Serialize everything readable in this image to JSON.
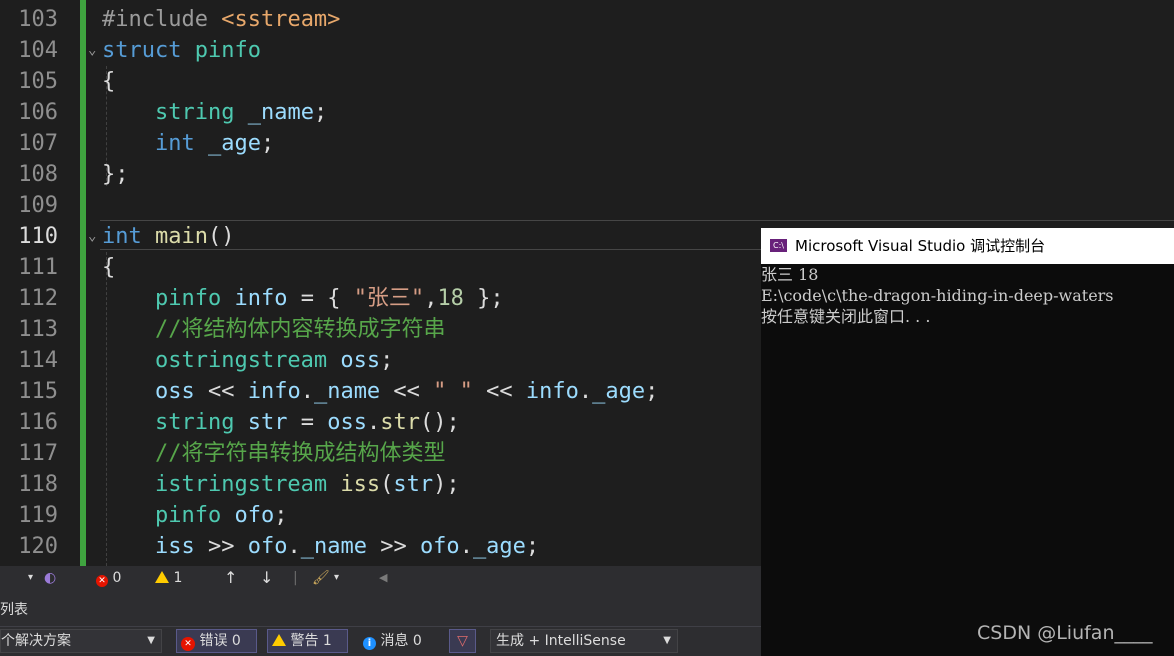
{
  "editor": {
    "current_line": "110",
    "lines": [
      {
        "n": "103",
        "t": [
          {
            "c": "pp",
            "s": "#include "
          },
          {
            "c": "inc",
            "s": "<sstream>"
          }
        ]
      },
      {
        "n": "104",
        "t": [
          {
            "c": "kw",
            "s": "struct"
          },
          {
            "c": "",
            "s": " "
          },
          {
            "c": "ty",
            "s": "pinfo"
          }
        ]
      },
      {
        "n": "105",
        "t": [
          {
            "c": "",
            "s": "{"
          }
        ]
      },
      {
        "n": "106",
        "t": [
          {
            "c": "",
            "s": "    "
          },
          {
            "c": "ty",
            "s": "string"
          },
          {
            "c": "",
            "s": " "
          },
          {
            "c": "var",
            "s": "_name"
          },
          {
            "c": "",
            "s": ";"
          }
        ]
      },
      {
        "n": "107",
        "t": [
          {
            "c": "",
            "s": "    "
          },
          {
            "c": "kw",
            "s": "int"
          },
          {
            "c": "",
            "s": " "
          },
          {
            "c": "var",
            "s": "_age"
          },
          {
            "c": "",
            "s": ";"
          }
        ]
      },
      {
        "n": "108",
        "t": [
          {
            "c": "",
            "s": "};"
          }
        ]
      },
      {
        "n": "109",
        "t": []
      },
      {
        "n": "110",
        "t": [
          {
            "c": "kw",
            "s": "int"
          },
          {
            "c": "",
            "s": " "
          },
          {
            "c": "fn",
            "s": "main"
          },
          {
            "c": "",
            "s": "()"
          }
        ]
      },
      {
        "n": "111",
        "t": [
          {
            "c": "",
            "s": "{"
          }
        ]
      },
      {
        "n": "112",
        "t": [
          {
            "c": "",
            "s": "    "
          },
          {
            "c": "ty",
            "s": "pinfo"
          },
          {
            "c": "",
            "s": " "
          },
          {
            "c": "var",
            "s": "info"
          },
          {
            "c": "",
            "s": " = { "
          },
          {
            "c": "str",
            "s": "\"张三\""
          },
          {
            "c": "",
            "s": ","
          },
          {
            "c": "num",
            "s": "18"
          },
          {
            "c": "",
            "s": " };"
          }
        ]
      },
      {
        "n": "113",
        "t": [
          {
            "c": "",
            "s": "    "
          },
          {
            "c": "com",
            "s": "//将结构体内容转换成字符串"
          }
        ]
      },
      {
        "n": "114",
        "t": [
          {
            "c": "",
            "s": "    "
          },
          {
            "c": "ty",
            "s": "ostringstream"
          },
          {
            "c": "",
            "s": " "
          },
          {
            "c": "var",
            "s": "oss"
          },
          {
            "c": "",
            "s": ";"
          }
        ]
      },
      {
        "n": "115",
        "t": [
          {
            "c": "",
            "s": "    "
          },
          {
            "c": "var",
            "s": "oss"
          },
          {
            "c": "",
            "s": " << "
          },
          {
            "c": "var",
            "s": "info"
          },
          {
            "c": "",
            "s": "."
          },
          {
            "c": "var",
            "s": "_name"
          },
          {
            "c": "",
            "s": " << "
          },
          {
            "c": "str",
            "s": "\" \""
          },
          {
            "c": "",
            "s": " << "
          },
          {
            "c": "var",
            "s": "info"
          },
          {
            "c": "",
            "s": "."
          },
          {
            "c": "var",
            "s": "_age"
          },
          {
            "c": "",
            "s": ";"
          }
        ]
      },
      {
        "n": "116",
        "t": [
          {
            "c": "",
            "s": "    "
          },
          {
            "c": "ty",
            "s": "string"
          },
          {
            "c": "",
            "s": " "
          },
          {
            "c": "var",
            "s": "str"
          },
          {
            "c": "",
            "s": " = "
          },
          {
            "c": "var",
            "s": "oss"
          },
          {
            "c": "",
            "s": "."
          },
          {
            "c": "fn",
            "s": "str"
          },
          {
            "c": "",
            "s": "();"
          }
        ]
      },
      {
        "n": "117",
        "t": [
          {
            "c": "",
            "s": "    "
          },
          {
            "c": "com",
            "s": "//将字符串转换成结构体类型"
          }
        ]
      },
      {
        "n": "118",
        "t": [
          {
            "c": "",
            "s": "    "
          },
          {
            "c": "ty",
            "s": "istringstream"
          },
          {
            "c": "",
            "s": " "
          },
          {
            "c": "fn",
            "s": "iss"
          },
          {
            "c": "",
            "s": "("
          },
          {
            "c": "var",
            "s": "str"
          },
          {
            "c": "",
            "s": ");"
          }
        ]
      },
      {
        "n": "119",
        "t": [
          {
            "c": "",
            "s": "    "
          },
          {
            "c": "ty",
            "s": "pinfo"
          },
          {
            "c": "",
            "s": " "
          },
          {
            "c": "var",
            "s": "ofo"
          },
          {
            "c": "",
            "s": ";"
          }
        ]
      },
      {
        "n": "120",
        "t": [
          {
            "c": "",
            "s": "    "
          },
          {
            "c": "var",
            "s": "iss"
          },
          {
            "c": "",
            "s": " >> "
          },
          {
            "c": "var",
            "s": "ofo"
          },
          {
            "c": "",
            "s": "."
          },
          {
            "c": "var",
            "s": "_name"
          },
          {
            "c": "",
            "s": " >> "
          },
          {
            "c": "var",
            "s": "ofo"
          },
          {
            "c": "",
            "s": "."
          },
          {
            "c": "var",
            "s": "_age"
          },
          {
            "c": "",
            "s": ";"
          }
        ]
      }
    ]
  },
  "console": {
    "title": "Microsoft Visual Studio 调试控制台",
    "icon_text": "C:\\",
    "output_lines": [
      "张三 18",
      "E:\\code\\c\\the-dragon-hiding-in-deep-waters",
      "按任意键关闭此窗口. . ."
    ],
    "watermark": "CSDN @Liufan____"
  },
  "status_bar": {
    "errors": "0",
    "warnings": "1",
    "up_arrow": "↑",
    "down_arrow": "↓",
    "left_arrow": "◀"
  },
  "error_list": {
    "title": "列表",
    "scope_selected": "个解决方案",
    "errors_label": "错误 0",
    "warnings_label": "警告 1",
    "messages_label": "消息 0",
    "build_filter": "生成 + IntelliSense"
  }
}
